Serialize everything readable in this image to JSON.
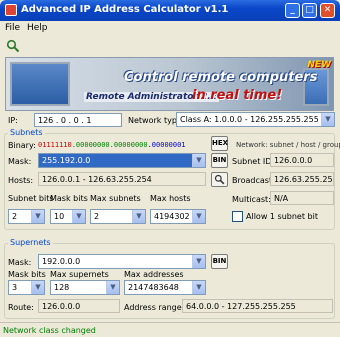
{
  "window": {
    "title": "Advanced IP Address Calculator v1.1",
    "minimize": "_",
    "maximize": "□",
    "close": "✕"
  },
  "menu": [
    "File",
    "Help"
  ],
  "banner": {
    "line1": "Control remote computers",
    "line2": "Remote Administrator 2.2",
    "line3": "in real time!",
    "badge": "NEW"
  },
  "ip_row": {
    "ip_label": "IP:",
    "ip_value": "126 . 0 . 0 . 1",
    "network_type_label": "Network type:",
    "network_type_value": "Class A:   1.0.0.0 - 126.255.255.255"
  },
  "subnets": {
    "title": "Subnets",
    "binary_label": "Binary:",
    "binary_parts": [
      "01111110",
      ".00000000",
      ".00000000",
      ".00000001"
    ],
    "network_info": "Network: subnet / host / group",
    "mask_label": "Mask:",
    "mask_value": "255.192.0.0",
    "hex_button": "HEX",
    "subnet_id_label": "Subnet ID:",
    "subnet_id_value": "126.0.0.0",
    "bin_button": "BIN",
    "hosts_label": "Hosts:",
    "hosts_value": "126.0.0.1 - 126.63.255.254",
    "broadcast_label": "Broadcast:",
    "broadcast_value": "126.63.255.255",
    "subnet_bits_label": "Subnet bits",
    "subnet_bits_value": "2",
    "mask_bits_label": "Mask bits",
    "mask_bits_value": "10",
    "max_subnets_label": "Max subnets",
    "max_subnets_value": "2",
    "max_hosts_label": "Max hosts",
    "max_hosts_value": "4194302",
    "multicast_label": "Multicast:",
    "multicast_value": "N/A",
    "allow_label": "Allow 1 subnet bit"
  },
  "supernets": {
    "title": "Supernets",
    "mask_label": "Mask:",
    "mask_value": "192.0.0.0",
    "bin_button": "BIN",
    "mask_bits_label": "Mask bits",
    "mask_bits_value": "3",
    "max_supernets_label": "Max supernets",
    "max_supernets_value": "128",
    "max_addresses_label": "Max addresses",
    "max_addresses_value": "2147483648",
    "route_label": "Route:",
    "route_value": "126.0.0.0",
    "address_range_label": "Address range:",
    "address_range_value": "64.0.0.0 - 127.255.255.255"
  },
  "status": "Network class changed",
  "colors": {
    "title_blue": "#0a46c8",
    "group_title": "#0046d5",
    "selection": "#316ac5",
    "status_green": "#008000",
    "binary_red": "#d00000"
  }
}
